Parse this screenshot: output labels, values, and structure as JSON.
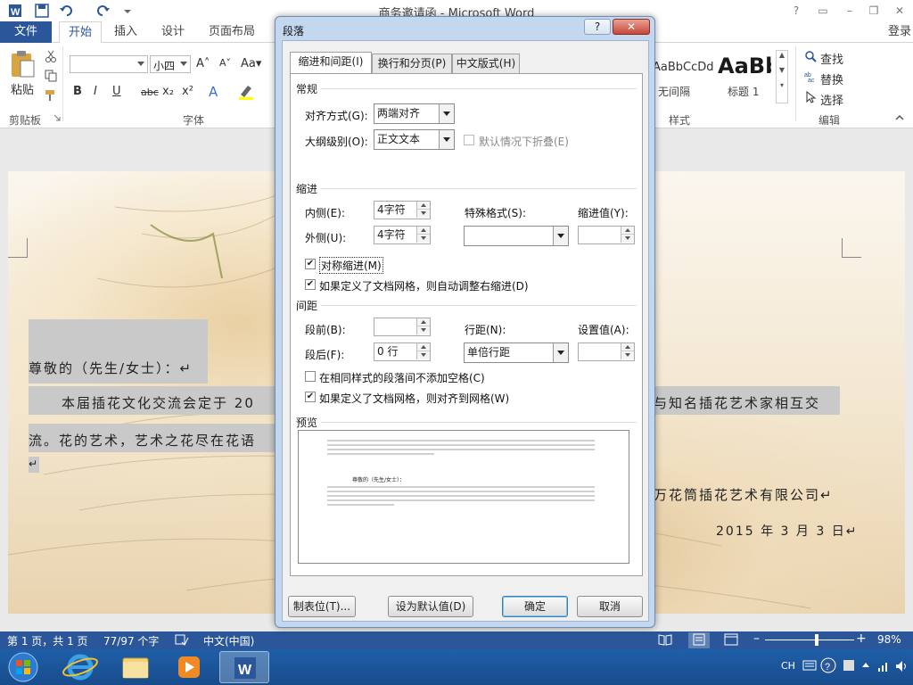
{
  "app": {
    "title": "商务邀请函 - Microsoft Word",
    "login": "登录"
  },
  "tabs": {
    "file": "文件",
    "items": [
      "开始",
      "插入",
      "设计",
      "页面布局"
    ]
  },
  "ribbon": {
    "paste_label": "粘贴",
    "clipboard_label": "剪贴板",
    "font_label": "字体",
    "font_size": "小四",
    "styles": {
      "style1_preview": "AaBbCcDd",
      "style1_name": "无间隔",
      "style2_preview": "AaBb",
      "style2_name": "标题 1",
      "group_label": "样式"
    },
    "editing": {
      "find": "查找",
      "replace": "替换",
      "select": "选择",
      "group_label": "编辑"
    }
  },
  "document": {
    "salutation": "尊敬的（先生/女士）：↵",
    "body_start": "本届插花文化交流会定于 20",
    "body_end": "与知名插花艺术家相互交",
    "line2": "流。花的艺术，艺术之花尽在花语",
    "para_mark": "↵",
    "company": "万花筒插花艺术有限公司↵",
    "date": "2015 年 3 月 3 日↵"
  },
  "dialog": {
    "title": "段落",
    "help": "?",
    "close": "✕",
    "tabs": [
      "缩进和间距(I)",
      "换行和分页(P)",
      "中文版式(H)"
    ],
    "general": {
      "section": "常规",
      "alignment_label": "对齐方式(G):",
      "alignment_value": "两端对齐",
      "outline_label": "大纲级别(O):",
      "outline_value": "正文文本",
      "collapse_label": "默认情况下折叠(E)"
    },
    "indent": {
      "section": "缩进",
      "inside_label": "内侧(E):",
      "inside_value": "4字符",
      "outside_label": "外侧(U):",
      "outside_value": "4字符",
      "special_label": "特殊格式(S):",
      "special_value": "",
      "by_label": "缩进值(Y):",
      "by_value": "",
      "mirror_label": "对称缩进(M)",
      "mirror_checked": "✔",
      "grid_label": "如果定义了文档网格，则自动调整右缩进(D)",
      "grid_checked": "✔"
    },
    "spacing": {
      "section": "间距",
      "before_label": "段前(B):",
      "before_value": "",
      "after_label": "段后(F):",
      "after_value": "0 行",
      "line_label": "行距(N):",
      "line_value": "单倍行距",
      "at_label": "设置值(A):",
      "at_value": "",
      "nospace_label": "在相同样式的段落间不添加空格(C)",
      "snap_label": "如果定义了文档网格，则对齐到网格(W)",
      "snap_checked": "✔"
    },
    "preview": {
      "section": "预览",
      "sample": "尊敬的（先生/女士）："
    },
    "buttons": {
      "tabs": "制表位(T)...",
      "default": "设为默认值(D)",
      "ok": "确定",
      "cancel": "取消"
    }
  },
  "status": {
    "page": "第 1 页，共 1 页",
    "words": "77/97 个字",
    "language": "中文(中国)",
    "zoom": "98%",
    "zoom_level": 0.58
  },
  "taskbar": {
    "ime": "CH"
  },
  "colors": {
    "word_blue": "#2b579a",
    "taskbar": "#1f5fa8",
    "dialog_frame": "#c3d7ee"
  }
}
